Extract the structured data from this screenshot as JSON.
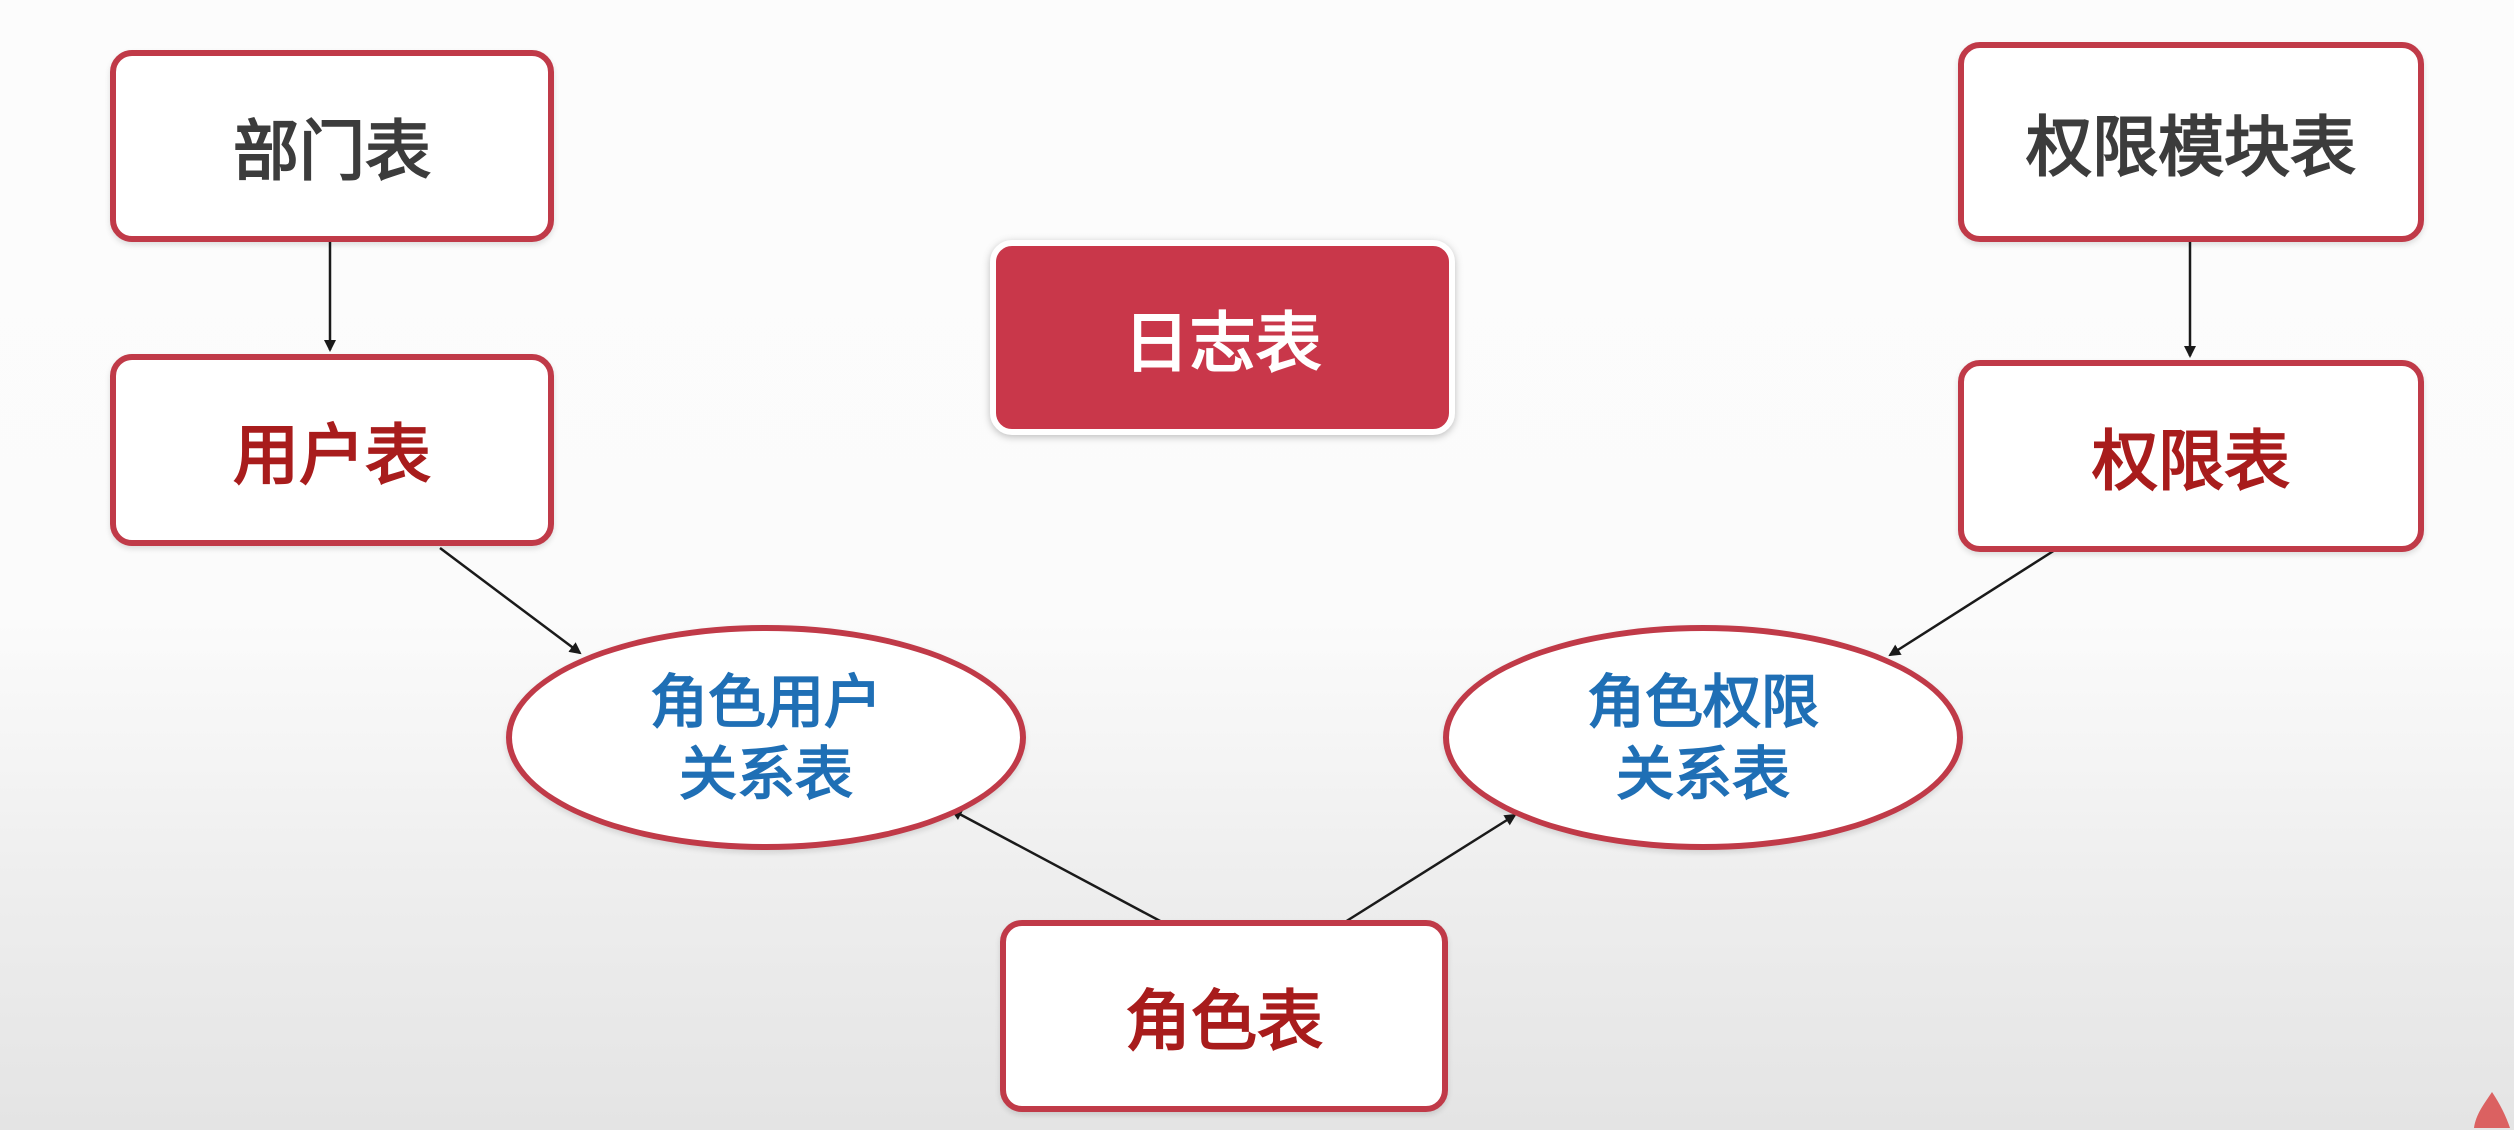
{
  "nodes": {
    "department": "部门表",
    "user": "用户表",
    "log": "日志表",
    "permission_module": "权限模块表",
    "permission": "权限表",
    "role_user_line1": "角色用户",
    "role_user_line2": "关系表",
    "role_permission_line1": "角色权限",
    "role_permission_line2": "关系表",
    "role": "角色表"
  },
  "colors": {
    "border": "#c03a48",
    "log_fill": "#c9374a",
    "red_text": "#a81c1c",
    "gray_text": "#3c3c3c",
    "blue_text": "#1f6fb5",
    "arrow": "#1a1a1a"
  }
}
